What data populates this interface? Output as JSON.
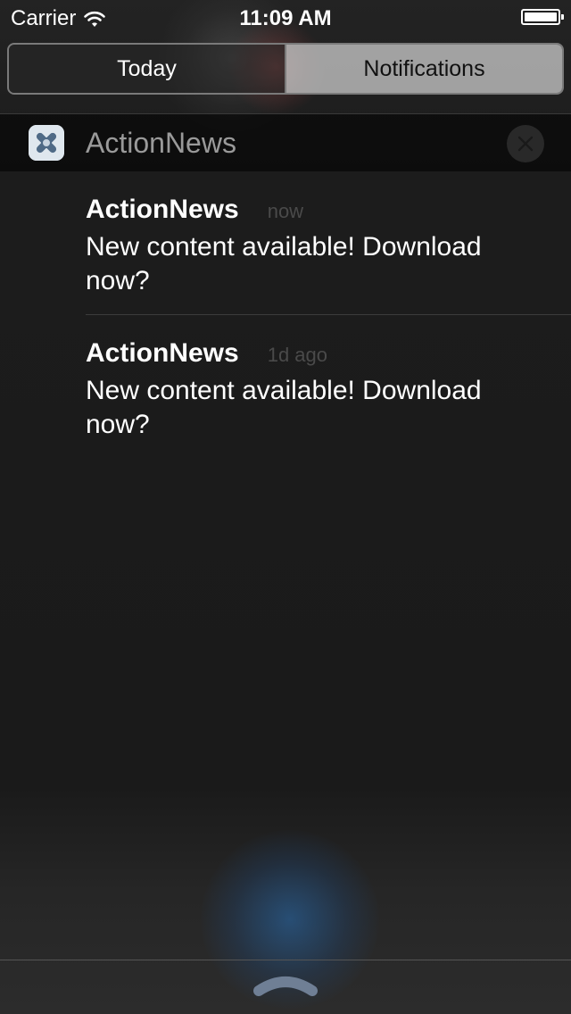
{
  "status_bar": {
    "carrier": "Carrier",
    "time": "11:09 AM",
    "wifi_icon": "wifi-icon",
    "battery_icon": "battery-icon"
  },
  "segments": [
    {
      "label": "Today",
      "selected": true
    },
    {
      "label": "Notifications",
      "selected": false
    }
  ],
  "section": {
    "app_icon": "app-icon",
    "title": "ActionNews",
    "clear_icon": "close-icon"
  },
  "notifications": [
    {
      "app": "ActionNews",
      "time": "now",
      "message": "New content available! Download now?"
    },
    {
      "app": "ActionNews",
      "time": "1d ago",
      "message": "New content available! Download now?"
    }
  ],
  "bottom": {
    "grabber_icon": "chevron-up-icon"
  },
  "colors": {
    "background": "#1b1b1b",
    "segment_selected_bg": "#2a2a2a",
    "segment_unselected_bg": "#bebebe",
    "muted_text": "#9a9a9a",
    "timestamp_text": "#4a4a4a"
  }
}
